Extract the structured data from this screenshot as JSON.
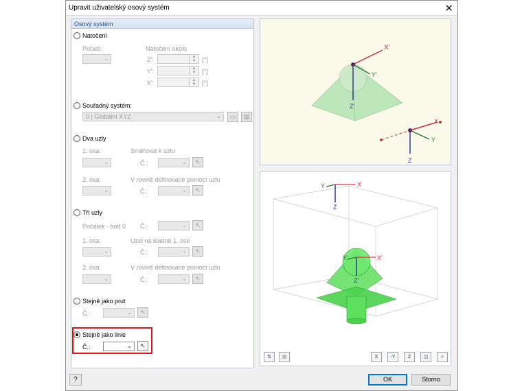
{
  "window": {
    "title": "Upravit uživatelský osový systém",
    "close": "✕"
  },
  "panel": {
    "header": "Osový systém"
  },
  "rotation": {
    "label": "Natočení",
    "order_label": "Pořadí:",
    "about_label": "Natočení okolo",
    "z_label": "Z':",
    "y_label": "Y':",
    "x_label": "X':",
    "unit": "[°]"
  },
  "coord_system": {
    "label": "Souřadný systém:",
    "value": "0 | Globální XYZ"
  },
  "two_nodes": {
    "label": "Dva uzly",
    "axis1_label": "1. osa:",
    "direct_label": "Směřovat k uzlu",
    "no_label": "Č.:",
    "axis2_label": "2. osa:",
    "plane_label": "V rovině definované pomocí uzlu",
    "no2_label": "Č.:"
  },
  "three_nodes": {
    "label": "Tři uzly",
    "origin_label": "Počátek - bod 0",
    "no0_label": "Č.:",
    "axis1_label": "1. osa:",
    "node_label": "Uzel na kladné 1. ose",
    "no1_label": "Č.:",
    "axis2_label": "2. osa:",
    "plane_label": "V rovině definované pomocí uzlu",
    "no2_label": "Č.:"
  },
  "same_member": {
    "label": "Stejně jako prut",
    "no_label": "Č.:"
  },
  "same_line": {
    "label": "Stejně jako linie",
    "no_label": "Č.:"
  },
  "preview_top": {
    "x": "X'",
    "y": "Y'",
    "z": "Z'",
    "gx": "X",
    "gy": "Y",
    "gz": "Z"
  },
  "preview_bottom": {
    "x": "X",
    "y": "Y",
    "z": "Z",
    "lx": "X'",
    "ly": "Y'",
    "lz": "Z'"
  },
  "buttons": {
    "ok": "OK",
    "cancel": "Storno",
    "help": "?"
  },
  "colors": {
    "accent": "#0078d7",
    "highlight": "#e0161c",
    "green": "#4cd24c"
  }
}
